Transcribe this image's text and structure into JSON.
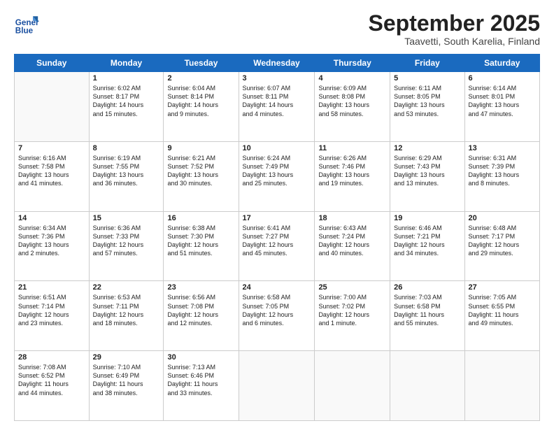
{
  "header": {
    "logo_line1": "General",
    "logo_line2": "Blue",
    "month": "September 2025",
    "location": "Taavetti, South Karelia, Finland"
  },
  "weekdays": [
    "Sunday",
    "Monday",
    "Tuesday",
    "Wednesday",
    "Thursday",
    "Friday",
    "Saturday"
  ],
  "weeks": [
    [
      {
        "day": "",
        "info": ""
      },
      {
        "day": "1",
        "info": "Sunrise: 6:02 AM\nSunset: 8:17 PM\nDaylight: 14 hours\nand 15 minutes."
      },
      {
        "day": "2",
        "info": "Sunrise: 6:04 AM\nSunset: 8:14 PM\nDaylight: 14 hours\nand 9 minutes."
      },
      {
        "day": "3",
        "info": "Sunrise: 6:07 AM\nSunset: 8:11 PM\nDaylight: 14 hours\nand 4 minutes."
      },
      {
        "day": "4",
        "info": "Sunrise: 6:09 AM\nSunset: 8:08 PM\nDaylight: 13 hours\nand 58 minutes."
      },
      {
        "day": "5",
        "info": "Sunrise: 6:11 AM\nSunset: 8:05 PM\nDaylight: 13 hours\nand 53 minutes."
      },
      {
        "day": "6",
        "info": "Sunrise: 6:14 AM\nSunset: 8:01 PM\nDaylight: 13 hours\nand 47 minutes."
      }
    ],
    [
      {
        "day": "7",
        "info": "Sunrise: 6:16 AM\nSunset: 7:58 PM\nDaylight: 13 hours\nand 41 minutes."
      },
      {
        "day": "8",
        "info": "Sunrise: 6:19 AM\nSunset: 7:55 PM\nDaylight: 13 hours\nand 36 minutes."
      },
      {
        "day": "9",
        "info": "Sunrise: 6:21 AM\nSunset: 7:52 PM\nDaylight: 13 hours\nand 30 minutes."
      },
      {
        "day": "10",
        "info": "Sunrise: 6:24 AM\nSunset: 7:49 PM\nDaylight: 13 hours\nand 25 minutes."
      },
      {
        "day": "11",
        "info": "Sunrise: 6:26 AM\nSunset: 7:46 PM\nDaylight: 13 hours\nand 19 minutes."
      },
      {
        "day": "12",
        "info": "Sunrise: 6:29 AM\nSunset: 7:43 PM\nDaylight: 13 hours\nand 13 minutes."
      },
      {
        "day": "13",
        "info": "Sunrise: 6:31 AM\nSunset: 7:39 PM\nDaylight: 13 hours\nand 8 minutes."
      }
    ],
    [
      {
        "day": "14",
        "info": "Sunrise: 6:34 AM\nSunset: 7:36 PM\nDaylight: 13 hours\nand 2 minutes."
      },
      {
        "day": "15",
        "info": "Sunrise: 6:36 AM\nSunset: 7:33 PM\nDaylight: 12 hours\nand 57 minutes."
      },
      {
        "day": "16",
        "info": "Sunrise: 6:38 AM\nSunset: 7:30 PM\nDaylight: 12 hours\nand 51 minutes."
      },
      {
        "day": "17",
        "info": "Sunrise: 6:41 AM\nSunset: 7:27 PM\nDaylight: 12 hours\nand 45 minutes."
      },
      {
        "day": "18",
        "info": "Sunrise: 6:43 AM\nSunset: 7:24 PM\nDaylight: 12 hours\nand 40 minutes."
      },
      {
        "day": "19",
        "info": "Sunrise: 6:46 AM\nSunset: 7:21 PM\nDaylight: 12 hours\nand 34 minutes."
      },
      {
        "day": "20",
        "info": "Sunrise: 6:48 AM\nSunset: 7:17 PM\nDaylight: 12 hours\nand 29 minutes."
      }
    ],
    [
      {
        "day": "21",
        "info": "Sunrise: 6:51 AM\nSunset: 7:14 PM\nDaylight: 12 hours\nand 23 minutes."
      },
      {
        "day": "22",
        "info": "Sunrise: 6:53 AM\nSunset: 7:11 PM\nDaylight: 12 hours\nand 18 minutes."
      },
      {
        "day": "23",
        "info": "Sunrise: 6:56 AM\nSunset: 7:08 PM\nDaylight: 12 hours\nand 12 minutes."
      },
      {
        "day": "24",
        "info": "Sunrise: 6:58 AM\nSunset: 7:05 PM\nDaylight: 12 hours\nand 6 minutes."
      },
      {
        "day": "25",
        "info": "Sunrise: 7:00 AM\nSunset: 7:02 PM\nDaylight: 12 hours\nand 1 minute."
      },
      {
        "day": "26",
        "info": "Sunrise: 7:03 AM\nSunset: 6:58 PM\nDaylight: 11 hours\nand 55 minutes."
      },
      {
        "day": "27",
        "info": "Sunrise: 7:05 AM\nSunset: 6:55 PM\nDaylight: 11 hours\nand 49 minutes."
      }
    ],
    [
      {
        "day": "28",
        "info": "Sunrise: 7:08 AM\nSunset: 6:52 PM\nDaylight: 11 hours\nand 44 minutes."
      },
      {
        "day": "29",
        "info": "Sunrise: 7:10 AM\nSunset: 6:49 PM\nDaylight: 11 hours\nand 38 minutes."
      },
      {
        "day": "30",
        "info": "Sunrise: 7:13 AM\nSunset: 6:46 PM\nDaylight: 11 hours\nand 33 minutes."
      },
      {
        "day": "",
        "info": ""
      },
      {
        "day": "",
        "info": ""
      },
      {
        "day": "",
        "info": ""
      },
      {
        "day": "",
        "info": ""
      }
    ]
  ]
}
